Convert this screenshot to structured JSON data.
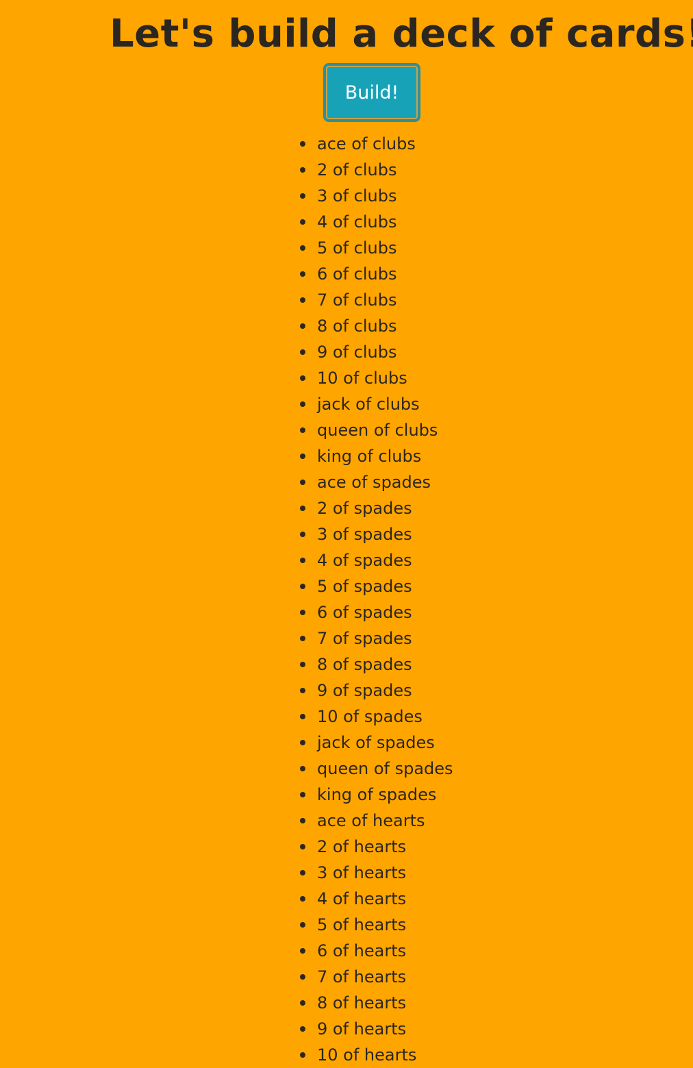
{
  "page": {
    "title": "Let's build a deck of cards!",
    "build_button_label": "Build!",
    "background_color": "#ffa500",
    "button_color": "#17a2b8"
  },
  "cards": [
    "ace of clubs",
    "2 of clubs",
    "3 of clubs",
    "4 of clubs",
    "5 of clubs",
    "6 of clubs",
    "7 of clubs",
    "8 of clubs",
    "9 of clubs",
    "10 of clubs",
    "jack of clubs",
    "queen of clubs",
    "king of clubs",
    "ace of spades",
    "2 of spades",
    "3 of spades",
    "4 of spades",
    "5 of spades",
    "6 of spades",
    "7 of spades",
    "8 of spades",
    "9 of spades",
    "10 of spades",
    "jack of spades",
    "queen of spades",
    "king of spades",
    "ace of hearts",
    "2 of hearts",
    "3 of hearts",
    "4 of hearts",
    "5 of hearts",
    "6 of hearts",
    "7 of hearts",
    "8 of hearts",
    "9 of hearts",
    "10 of hearts"
  ]
}
